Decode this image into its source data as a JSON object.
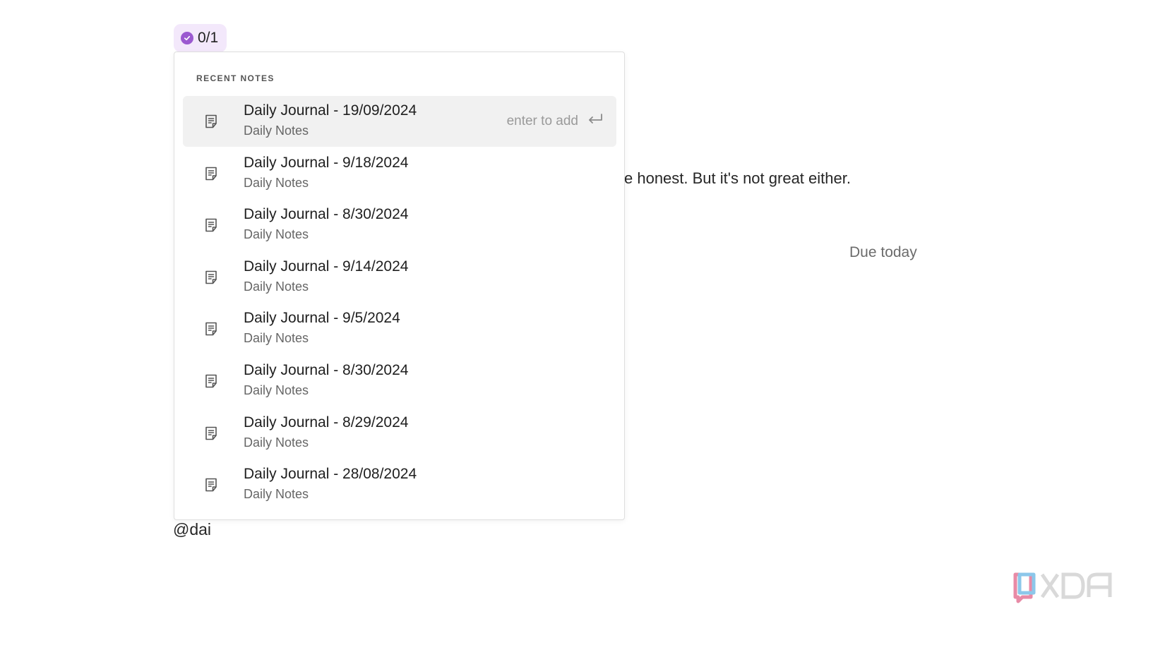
{
  "task_chip": {
    "count": "0/1"
  },
  "background": {
    "body_text": "e honest. But it's not great either.",
    "due_label": "Due today",
    "mention_input": "@dai"
  },
  "popover": {
    "section_label": "RECENT NOTES",
    "enter_hint": "enter to add",
    "items": [
      {
        "title": "Daily Journal - 19/09/2024",
        "subtitle": "Daily Notes"
      },
      {
        "title": "Daily Journal - 9/18/2024",
        "subtitle": "Daily Notes"
      },
      {
        "title": "Daily Journal - 8/30/2024",
        "subtitle": "Daily Notes"
      },
      {
        "title": "Daily Journal - 9/14/2024",
        "subtitle": "Daily Notes"
      },
      {
        "title": "Daily Journal - 9/5/2024",
        "subtitle": "Daily Notes"
      },
      {
        "title": "Daily Journal - 8/30/2024",
        "subtitle": "Daily Notes"
      },
      {
        "title": "Daily Journal - 8/29/2024",
        "subtitle": "Daily Notes"
      },
      {
        "title": "Daily Journal - 28/08/2024",
        "subtitle": "Daily Notes"
      }
    ]
  },
  "watermark": {
    "text": "XDA"
  },
  "colors": {
    "accent": "#9b59d0",
    "chip_bg": "#f3e8fb",
    "active_row": "#f1f1f1"
  },
  "icons": {
    "note": "document-icon",
    "enter": "enter-key-icon",
    "check": "check-circle-icon"
  }
}
